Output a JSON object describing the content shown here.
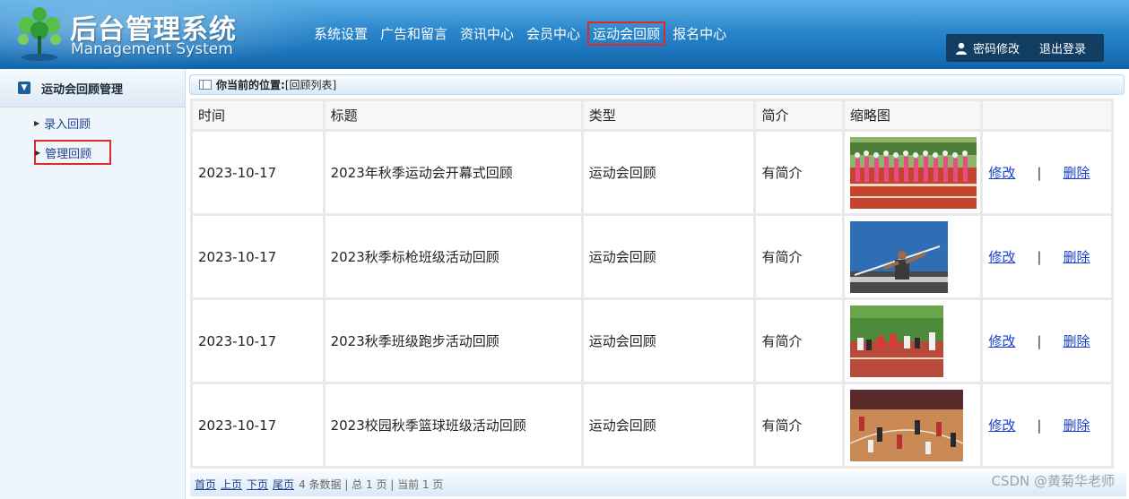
{
  "header": {
    "brand_title": "后台管理系统",
    "brand_subtitle": "Management System",
    "nav": [
      "系统设置",
      "广告和留言",
      "资讯中心",
      "会员中心",
      "运动会回顾",
      "报名中心"
    ],
    "active_nav": "运动会回顾",
    "user_menu": {
      "change_password": "密码修改",
      "logout": "退出登录"
    }
  },
  "sidebar": {
    "group_title": "运动会回顾管理",
    "items": [
      {
        "label": "录入回顾"
      },
      {
        "label": "管理回顾"
      }
    ],
    "selected_item": "管理回顾"
  },
  "breadcrumb": {
    "label": "你当前的位置:",
    "value": "[回顾列表]"
  },
  "table": {
    "headers": [
      "时间",
      "标题",
      "类型",
      "简介",
      "缩略图",
      ""
    ],
    "rows": [
      {
        "time": "2023-10-17",
        "title": "2023年秋季运动会开幕式回顾",
        "type": "运动会回顾",
        "brief": "有简介",
        "thumb": "opening-ceremony-photo",
        "edit": "修改",
        "sep": "|",
        "delete": "删除"
      },
      {
        "time": "2023-10-17",
        "title": "2023秋季标枪班级活动回顾",
        "type": "运动会回顾",
        "brief": "有简介",
        "thumb": "javelin-photo",
        "edit": "修改",
        "sep": "|",
        "delete": "删除"
      },
      {
        "time": "2023-10-17",
        "title": "2023秋季班级跑步活动回顾",
        "type": "运动会回顾",
        "brief": "有简介",
        "thumb": "running-photo",
        "edit": "修改",
        "sep": "|",
        "delete": "删除"
      },
      {
        "time": "2023-10-17",
        "title": "2023校园秋季篮球班级活动回顾",
        "type": "运动会回顾",
        "brief": "有简介",
        "thumb": "basketball-photo",
        "edit": "修改",
        "sep": "|",
        "delete": "删除"
      }
    ]
  },
  "pager": {
    "first": "首页",
    "prev": "上页",
    "next": "下页",
    "last": "尾页",
    "info": "4 条数据 | 总 1 页 | 当前 1 页"
  },
  "watermark": "CSDN @黄菊华老师",
  "colors": {
    "header_blue": "#2a86cc",
    "highlight_red": "#e02828",
    "link_blue": "#1a3fcc"
  }
}
